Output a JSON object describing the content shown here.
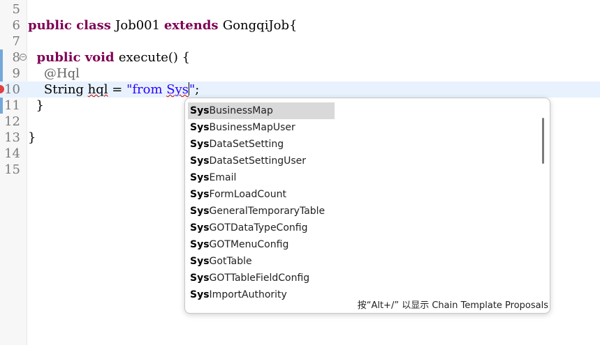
{
  "editor": {
    "lines": [
      {
        "num": "5",
        "tokens": []
      },
      {
        "num": "6",
        "tokens": [
          {
            "t": "public class ",
            "c": "kw"
          },
          {
            "t": "Job001 ",
            "c": ""
          },
          {
            "t": "extends ",
            "c": "kw"
          },
          {
            "t": "GongqiJob{",
            "c": ""
          }
        ]
      },
      {
        "num": "7",
        "tokens": []
      },
      {
        "num": "8",
        "tokens": [
          {
            "t": "  public void ",
            "c": "kw"
          },
          {
            "t": "execute() {",
            "c": ""
          }
        ]
      },
      {
        "num": "9",
        "tokens": [
          {
            "t": "    @Hql",
            "c": "ann"
          }
        ]
      },
      {
        "num": "10",
        "tokens": [
          {
            "t": "    String ",
            "c": ""
          },
          {
            "t": "hql",
            "c": "squig"
          },
          {
            "t": " = ",
            "c": ""
          },
          {
            "t": "\"from ",
            "c": "str"
          },
          {
            "t": "Sys",
            "c": "str squig"
          },
          {
            "t": "|",
            "c": "caret"
          },
          {
            "t": "\"",
            "c": "str"
          },
          {
            "t": ";",
            "c": ""
          }
        ]
      },
      {
        "num": "11",
        "tokens": [
          {
            "t": "  }",
            "c": ""
          }
        ]
      },
      {
        "num": "12",
        "tokens": []
      },
      {
        "num": "13",
        "tokens": [
          {
            "t": "}",
            "c": ""
          }
        ]
      },
      {
        "num": "14",
        "tokens": []
      },
      {
        "num": "15",
        "tokens": []
      }
    ],
    "current_line": "10"
  },
  "autocomplete": {
    "prefix": "Sys",
    "items": [
      "BusinessMap",
      "BusinessMapUser",
      "DataSetSetting",
      "DataSetSettingUser",
      "Email",
      "FormLoadCount",
      "GeneralTemporaryTable",
      "GOTDataTypeConfig",
      "GOTMenuConfig",
      "GotTable",
      "GOTTableFieldConfig",
      "ImportAuthority"
    ],
    "selected_index": 0,
    "status_text": "按“Alt+/” 以显示 Chain Template Proposals"
  },
  "colors": {
    "keyword": "#7f0055",
    "string": "#2a00ff",
    "annotation": "#646464",
    "current_line": "#e8f2fe"
  }
}
